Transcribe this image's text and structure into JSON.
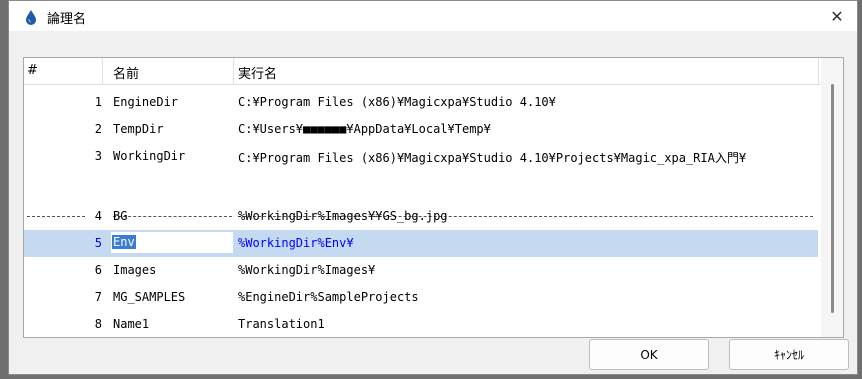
{
  "window": {
    "title": "論理名",
    "close_glyph": "✕",
    "accent": "#1e5aa8"
  },
  "grid": {
    "headers": {
      "num": "#",
      "name": "名前",
      "translation": "実行名"
    },
    "rows": [
      {
        "num": "1",
        "name": "EngineDir",
        "translation": "C:¥Program Files (x86)¥Magicxpa¥Studio 4.10¥"
      },
      {
        "num": "2",
        "name": "TempDir",
        "translation": "C:¥Users¥■■■■■■¥AppData¥Local¥Temp¥"
      },
      {
        "num": "3",
        "name": "WorkingDir",
        "translation": "C:¥Program Files (x86)¥Magicxpa¥Studio 4.10¥Projects¥Magic_xpa_RIA入門¥"
      },
      {
        "num": "4",
        "name": "BG",
        "translation": "%WorkingDir%Images¥¥GS_bg.jpg"
      },
      {
        "num": "5",
        "name": "Env",
        "translation": "%WorkingDir%Env¥",
        "selected": true
      },
      {
        "num": "6",
        "name": "Images",
        "translation": "%WorkingDir%Images¥"
      },
      {
        "num": "7",
        "name": "MG_SAMPLES",
        "translation": "%EngineDir%SampleProjects"
      },
      {
        "num": "8",
        "name": "Name1",
        "translation": "Translation1"
      }
    ]
  },
  "buttons": {
    "ok": "OK",
    "cancel": "ｷｬﾝｾﾙ"
  },
  "colors": {
    "selection": "#c5d9f1",
    "selected_text": "#0000ff",
    "edit_highlight": "#3a7bd5"
  }
}
